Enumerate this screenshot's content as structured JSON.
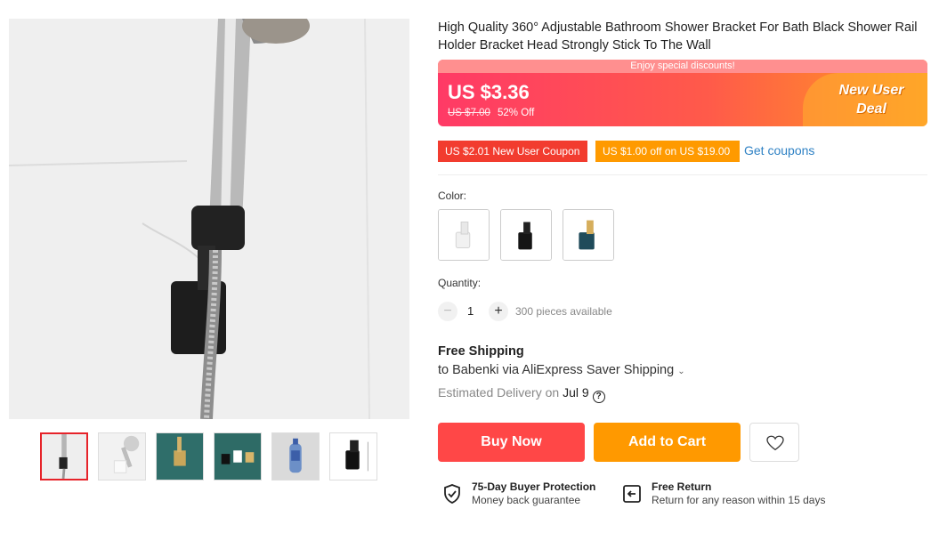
{
  "product": {
    "title": "High Quality 360° Adjustable Bathroom Shower Bracket For Bath Black Shower Rail Holder Bracket Head Strongly Stick To The Wall"
  },
  "deal": {
    "banner_text": "Enjoy special discounts!",
    "price": "US $3.36",
    "original_price": "US $7.00",
    "discount": "52% Off",
    "badge_line1": "New User",
    "badge_line2": "Deal"
  },
  "coupons": {
    "new_user": "US $2.01 New User Coupon",
    "off": "US $1.00 off on US $19.00",
    "get_coupons": "Get coupons"
  },
  "color": {
    "label": "Color:",
    "options": [
      "white",
      "black",
      "gold"
    ]
  },
  "quantity": {
    "label": "Quantity:",
    "minus": "−",
    "plus": "+",
    "value": "1",
    "available": "300 pieces available"
  },
  "shipping": {
    "title": "Free Shipping",
    "line": "to Babenki via AliExpress Saver Shipping",
    "chevron": "⌄",
    "delivery_prefix": "Estimated Delivery on",
    "delivery_date": "Jul 9",
    "help": "?"
  },
  "actions": {
    "buy_now": "Buy Now",
    "add_to_cart": "Add to Cart"
  },
  "guarantees": {
    "buyer_title": "75-Day Buyer Protection",
    "buyer_sub": "Money back guarantee",
    "return_title": "Free Return",
    "return_sub": "Return for any reason within 15 days"
  },
  "colors": {
    "price_red": "#ff4747",
    "cart_orange": "#ff9900",
    "link_blue": "#2e81c4",
    "coupon_red": "#f23c2f",
    "coupon_orange": "#ff9a00"
  },
  "icons": [
    "minus-icon",
    "plus-icon",
    "chevron-down-icon",
    "help-icon",
    "heart-icon",
    "shield-check-icon",
    "return-icon"
  ]
}
